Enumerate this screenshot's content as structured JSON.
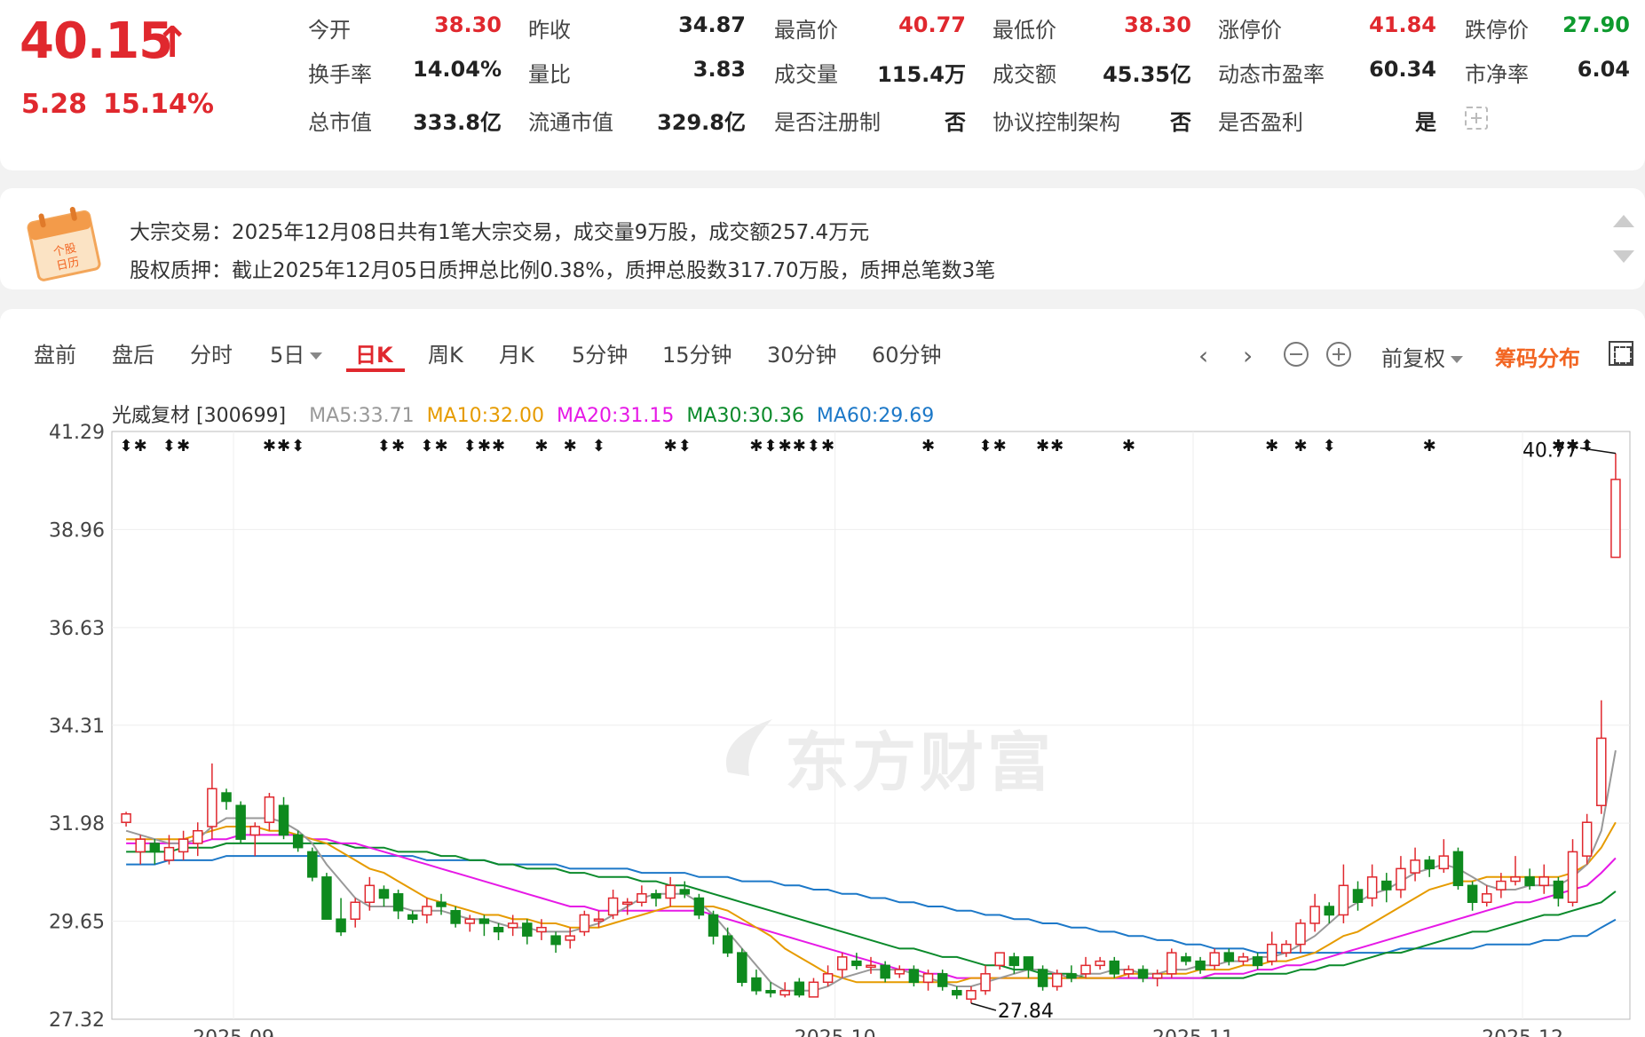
{
  "quote": {
    "price": "40.15",
    "arrow": "↑",
    "change": "5.28",
    "change_pct": "15.14%",
    "fields": [
      {
        "label": "今开",
        "value": "38.30",
        "color": "red"
      },
      {
        "label": "昨收",
        "value": "34.87",
        "color": "dark"
      },
      {
        "label": "最高价",
        "value": "40.77",
        "color": "red"
      },
      {
        "label": "最低价",
        "value": "38.30",
        "color": "red"
      },
      {
        "label": "涨停价",
        "value": "41.84",
        "color": "red"
      },
      {
        "label": "跌停价",
        "value": "27.90",
        "color": "green"
      },
      {
        "label": "换手率",
        "value": "14.04%",
        "color": "dark"
      },
      {
        "label": "量比",
        "value": "3.83",
        "color": "dark"
      },
      {
        "label": "成交量",
        "value": "115.4万",
        "color": "dark"
      },
      {
        "label": "成交额",
        "value": "45.35亿",
        "color": "dark"
      },
      {
        "label": "动态市盈率",
        "value": "60.34",
        "color": "dark"
      },
      {
        "label": "市净率",
        "value": "6.04",
        "color": "dark"
      },
      {
        "label": "总市值",
        "value": "333.8亿",
        "color": "dark"
      },
      {
        "label": "流通市值",
        "value": "329.8亿",
        "color": "dark"
      },
      {
        "label": "是否注册制",
        "value": "否",
        "color": "dark"
      },
      {
        "label": "协议控制架构",
        "value": "否",
        "color": "dark"
      },
      {
        "label": "是否盈利",
        "value": "是",
        "color": "dark"
      }
    ]
  },
  "notice": {
    "icon_text": "个股日历",
    "line1": "大宗交易：2025年12月08日共有1笔大宗交易，成交量9万股，成交额257.4万元",
    "line2": "股权质押：截止2025年12月05日质押总比例0.38%，质押总股数317.70万股，质押总笔数3笔"
  },
  "tabs": [
    {
      "label": "盘前",
      "active": false
    },
    {
      "label": "盘后",
      "active": false
    },
    {
      "label": "分时",
      "active": false
    },
    {
      "label": "5日",
      "active": false,
      "dropdown": true
    },
    {
      "label": "日K",
      "active": true
    },
    {
      "label": "周K",
      "active": false
    },
    {
      "label": "月K",
      "active": false
    },
    {
      "label": "5分钟",
      "active": false
    },
    {
      "label": "15分钟",
      "active": false
    },
    {
      "label": "30分钟",
      "active": false
    },
    {
      "label": "60分钟",
      "active": false
    }
  ],
  "toolbar": {
    "prev": "‹",
    "next": "›",
    "adjust": "前复权",
    "chip": "筹码分布"
  },
  "ma": {
    "name": "光威复材 [300699]",
    "items": [
      {
        "label": "MA5:33.71",
        "color": "#999999"
      },
      {
        "label": "MA10:32.00",
        "color": "#e69b00"
      },
      {
        "label": "MA20:31.15",
        "color": "#e619e6"
      },
      {
        "label": "MA30:30.36",
        "color": "#0b8a2b"
      },
      {
        "label": "MA60:29.69",
        "color": "#1c78c8"
      }
    ]
  },
  "watermark": "东方财富",
  "chart_data": {
    "type": "candlestick",
    "y_ticks": [
      "41.29",
      "38.96",
      "36.63",
      "34.31",
      "31.98",
      "29.65",
      "27.32"
    ],
    "ylim": [
      27.32,
      41.29
    ],
    "x_labels": [
      "2025-09",
      "2025-10",
      "2025-11",
      "2025-12"
    ],
    "high_label": "40.77",
    "low_label": "27.84",
    "colors": {
      "up": "#e0282e",
      "down": "#0e8a1e"
    },
    "candles": [
      [
        32.0,
        32.2,
        32.25,
        31.9
      ],
      [
        31.3,
        31.6,
        31.7,
        31.0
      ],
      [
        31.5,
        31.3,
        31.6,
        31.0
      ],
      [
        31.1,
        31.4,
        31.7,
        31.0
      ],
      [
        31.3,
        31.6,
        31.8,
        31.1
      ],
      [
        31.5,
        31.8,
        32.0,
        31.2
      ],
      [
        31.9,
        32.8,
        33.4,
        31.6
      ],
      [
        32.7,
        32.5,
        32.8,
        32.3
      ],
      [
        32.4,
        31.6,
        32.5,
        31.5
      ],
      [
        31.7,
        31.9,
        32.0,
        31.2
      ],
      [
        32.0,
        32.6,
        32.7,
        31.8
      ],
      [
        32.4,
        31.7,
        32.6,
        31.6
      ],
      [
        31.7,
        31.4,
        31.8,
        31.3
      ],
      [
        31.3,
        30.7,
        31.4,
        30.6
      ],
      [
        30.7,
        29.7,
        30.8,
        29.7
      ],
      [
        29.7,
        29.4,
        30.2,
        29.3
      ],
      [
        29.7,
        30.1,
        30.2,
        29.5
      ],
      [
        30.1,
        30.5,
        30.7,
        29.9
      ],
      [
        30.4,
        30.2,
        30.5,
        30.0
      ],
      [
        30.3,
        29.9,
        30.4,
        29.7
      ],
      [
        29.8,
        29.7,
        29.9,
        29.6
      ],
      [
        29.8,
        30.0,
        30.2,
        29.6
      ],
      [
        30.1,
        30.0,
        30.3,
        29.8
      ],
      [
        29.9,
        29.6,
        30.0,
        29.5
      ],
      [
        29.6,
        29.7,
        29.8,
        29.4
      ],
      [
        29.7,
        29.6,
        29.8,
        29.3
      ],
      [
        29.5,
        29.4,
        29.6,
        29.2
      ],
      [
        29.5,
        29.6,
        29.8,
        29.3
      ],
      [
        29.6,
        29.3,
        29.7,
        29.1
      ],
      [
        29.4,
        29.5,
        29.7,
        29.2
      ],
      [
        29.3,
        29.1,
        29.4,
        28.9
      ],
      [
        29.2,
        29.3,
        29.5,
        29.0
      ],
      [
        29.4,
        29.8,
        29.9,
        29.3
      ],
      [
        29.7,
        29.7,
        29.9,
        29.5
      ],
      [
        29.8,
        30.2,
        30.4,
        29.7
      ],
      [
        30.1,
        30.1,
        30.2,
        29.8
      ],
      [
        30.1,
        30.3,
        30.5,
        30.0
      ],
      [
        30.3,
        30.2,
        30.4,
        30.0
      ],
      [
        30.2,
        30.5,
        30.7,
        30.0
      ],
      [
        30.4,
        30.3,
        30.6,
        30.2
      ],
      [
        30.2,
        29.8,
        30.3,
        29.7
      ],
      [
        29.8,
        29.3,
        29.9,
        29.1
      ],
      [
        29.3,
        28.9,
        29.5,
        28.8
      ],
      [
        28.9,
        28.2,
        29.0,
        28.1
      ],
      [
        28.3,
        28.0,
        28.5,
        27.9
      ],
      [
        28.0,
        27.95,
        28.2,
        27.84
      ],
      [
        27.9,
        28.0,
        28.2,
        27.84
      ],
      [
        28.2,
        27.9,
        28.3,
        27.84
      ],
      [
        27.85,
        28.2,
        28.3,
        27.84
      ],
      [
        28.2,
        28.4,
        28.6,
        28.1
      ],
      [
        28.5,
        28.8,
        28.9,
        28.3
      ],
      [
        28.7,
        28.6,
        28.9,
        28.5
      ],
      [
        28.6,
        28.6,
        28.8,
        28.4
      ],
      [
        28.6,
        28.3,
        28.7,
        28.2
      ],
      [
        28.4,
        28.5,
        28.6,
        28.3
      ],
      [
        28.5,
        28.2,
        28.6,
        28.1
      ],
      [
        28.2,
        28.4,
        28.5,
        28.0
      ],
      [
        28.4,
        28.1,
        28.5,
        28.0
      ],
      [
        28.0,
        27.9,
        28.1,
        27.8
      ],
      [
        27.8,
        28.0,
        28.1,
        27.7
      ],
      [
        28.0,
        28.4,
        28.6,
        27.9
      ],
      [
        28.6,
        28.9,
        28.9,
        28.5
      ],
      [
        28.8,
        28.6,
        28.9,
        28.4
      ],
      [
        28.8,
        28.5,
        28.8,
        28.3
      ],
      [
        28.5,
        28.1,
        28.6,
        28.0
      ],
      [
        28.1,
        28.4,
        28.5,
        28.0
      ],
      [
        28.4,
        28.3,
        28.6,
        28.2
      ],
      [
        28.4,
        28.6,
        28.8,
        28.3
      ],
      [
        28.6,
        28.7,
        28.8,
        28.5
      ],
      [
        28.7,
        28.4,
        28.8,
        28.3
      ],
      [
        28.4,
        28.5,
        28.6,
        28.3
      ],
      [
        28.5,
        28.3,
        28.6,
        28.2
      ],
      [
        28.3,
        28.4,
        28.5,
        28.1
      ],
      [
        28.4,
        28.9,
        29.0,
        28.3
      ],
      [
        28.8,
        28.7,
        28.9,
        28.6
      ],
      [
        28.7,
        28.5,
        28.8,
        28.4
      ],
      [
        28.6,
        28.9,
        29.0,
        28.5
      ],
      [
        28.9,
        28.7,
        29.0,
        28.6
      ],
      [
        28.7,
        28.8,
        28.9,
        28.6
      ],
      [
        28.8,
        28.6,
        28.9,
        28.5
      ],
      [
        28.7,
        29.1,
        29.4,
        28.6
      ],
      [
        28.9,
        29.1,
        29.2,
        28.8
      ],
      [
        29.1,
        29.6,
        29.7,
        28.9
      ],
      [
        29.6,
        30.0,
        30.3,
        29.4
      ],
      [
        30.0,
        29.8,
        30.1,
        29.6
      ],
      [
        29.8,
        30.5,
        31.0,
        29.6
      ],
      [
        30.4,
        30.1,
        30.6,
        29.9
      ],
      [
        30.2,
        30.7,
        31.0,
        30.0
      ],
      [
        30.6,
        30.4,
        30.8,
        30.1
      ],
      [
        30.4,
        30.9,
        31.2,
        30.2
      ],
      [
        30.8,
        31.1,
        31.4,
        30.6
      ],
      [
        31.1,
        30.9,
        31.2,
        30.7
      ],
      [
        30.9,
        31.2,
        31.6,
        30.8
      ],
      [
        31.3,
        30.5,
        31.4,
        30.4
      ],
      [
        30.5,
        30.1,
        30.6,
        29.9
      ],
      [
        30.1,
        30.3,
        30.5,
        30.0
      ],
      [
        30.4,
        30.6,
        30.8,
        30.2
      ],
      [
        30.6,
        30.7,
        31.2,
        30.5
      ],
      [
        30.7,
        30.5,
        30.9,
        30.4
      ],
      [
        30.5,
        30.7,
        31.0,
        30.3
      ],
      [
        30.6,
        30.2,
        30.7,
        30.0
      ],
      [
        30.1,
        31.3,
        31.6,
        30.0
      ],
      [
        31.2,
        32.0,
        32.2,
        31.0
      ],
      [
        32.4,
        34.0,
        34.9,
        32.2
      ],
      [
        38.3,
        40.15,
        40.77,
        38.3
      ]
    ],
    "ma5": [
      31.8,
      31.7,
      31.6,
      31.5,
      31.5,
      31.6,
      31.9,
      32.1,
      32.1,
      32.1,
      32.1,
      32.0,
      31.8,
      31.5,
      31.0,
      30.6,
      30.2,
      30.0,
      30.0,
      30.0,
      29.9,
      29.9,
      29.9,
      29.8,
      29.7,
      29.7,
      29.6,
      29.5,
      29.5,
      29.4,
      29.4,
      29.4,
      29.5,
      29.6,
      29.8,
      30.0,
      30.2,
      30.3,
      30.3,
      30.3,
      30.1,
      29.8,
      29.4,
      29.0,
      28.6,
      28.2,
      28.0,
      28.0,
      28.0,
      28.1,
      28.3,
      28.4,
      28.5,
      28.5,
      28.5,
      28.4,
      28.3,
      28.2,
      28.1,
      28.1,
      28.2,
      28.3,
      28.4,
      28.5,
      28.5,
      28.4,
      28.3,
      28.4,
      28.4,
      28.5,
      28.5,
      28.4,
      28.4,
      28.5,
      28.5,
      28.6,
      28.6,
      28.7,
      28.7,
      28.8,
      28.8,
      28.9,
      29.1,
      29.3,
      29.6,
      29.9,
      30.1,
      30.3,
      30.4,
      30.6,
      30.8,
      30.9,
      31.0,
      30.9,
      30.7,
      30.5,
      30.4,
      30.4,
      30.5,
      30.5,
      30.5,
      30.7,
      31.0,
      31.8,
      33.71
    ],
    "ma10": [
      31.6,
      31.6,
      31.6,
      31.6,
      31.6,
      31.7,
      31.8,
      31.9,
      31.9,
      31.9,
      31.8,
      31.8,
      31.7,
      31.6,
      31.5,
      31.3,
      31.1,
      30.9,
      30.8,
      30.6,
      30.4,
      30.2,
      30.1,
      30.0,
      29.9,
      29.8,
      29.8,
      29.7,
      29.7,
      29.6,
      29.6,
      29.5,
      29.5,
      29.5,
      29.6,
      29.7,
      29.8,
      29.9,
      30.0,
      30.0,
      30.0,
      30.0,
      29.9,
      29.7,
      29.5,
      29.3,
      29.0,
      28.8,
      28.6,
      28.4,
      28.3,
      28.2,
      28.2,
      28.2,
      28.2,
      28.2,
      28.2,
      28.2,
      28.2,
      28.3,
      28.3,
      28.3,
      28.3,
      28.3,
      28.3,
      28.3,
      28.3,
      28.3,
      28.3,
      28.3,
      28.4,
      28.4,
      28.4,
      28.4,
      28.4,
      28.5,
      28.5,
      28.5,
      28.6,
      28.6,
      28.7,
      28.7,
      28.8,
      28.9,
      29.1,
      29.3,
      29.4,
      29.6,
      29.8,
      30.0,
      30.2,
      30.4,
      30.5,
      30.6,
      30.6,
      30.7,
      30.7,
      30.7,
      30.7,
      30.7,
      30.7,
      30.8,
      31.0,
      31.4,
      32.0
    ],
    "ma20": [
      31.5,
      31.5,
      31.5,
      31.5,
      31.5,
      31.5,
      31.6,
      31.6,
      31.7,
      31.7,
      31.7,
      31.7,
      31.7,
      31.6,
      31.6,
      31.5,
      31.5,
      31.4,
      31.3,
      31.2,
      31.1,
      31.0,
      30.9,
      30.8,
      30.7,
      30.6,
      30.5,
      30.4,
      30.3,
      30.2,
      30.1,
      30.0,
      30.0,
      29.9,
      29.9,
      29.9,
      29.9,
      29.9,
      29.9,
      29.9,
      29.9,
      29.8,
      29.7,
      29.6,
      29.5,
      29.4,
      29.3,
      29.2,
      29.1,
      29.0,
      28.9,
      28.8,
      28.7,
      28.6,
      28.5,
      28.5,
      28.4,
      28.4,
      28.3,
      28.3,
      28.3,
      28.3,
      28.3,
      28.3,
      28.3,
      28.3,
      28.3,
      28.3,
      28.3,
      28.3,
      28.3,
      28.3,
      28.3,
      28.3,
      28.3,
      28.3,
      28.4,
      28.4,
      28.4,
      28.5,
      28.5,
      28.6,
      28.6,
      28.7,
      28.8,
      28.9,
      29.0,
      29.1,
      29.2,
      29.3,
      29.4,
      29.5,
      29.6,
      29.7,
      29.8,
      29.9,
      30.0,
      30.1,
      30.1,
      30.2,
      30.3,
      30.4,
      30.5,
      30.8,
      31.15
    ],
    "ma30": [
      31.3,
      31.3,
      31.3,
      31.3,
      31.4,
      31.4,
      31.4,
      31.5,
      31.5,
      31.5,
      31.5,
      31.5,
      31.5,
      31.5,
      31.5,
      31.5,
      31.4,
      31.4,
      31.4,
      31.3,
      31.3,
      31.3,
      31.2,
      31.2,
      31.1,
      31.1,
      31.0,
      31.0,
      30.9,
      30.9,
      30.9,
      30.8,
      30.8,
      30.7,
      30.7,
      30.7,
      30.6,
      30.6,
      30.5,
      30.5,
      30.4,
      30.3,
      30.2,
      30.1,
      30.0,
      29.9,
      29.8,
      29.7,
      29.6,
      29.5,
      29.4,
      29.3,
      29.2,
      29.1,
      29.0,
      29.0,
      28.9,
      28.8,
      28.8,
      28.7,
      28.6,
      28.6,
      28.5,
      28.5,
      28.4,
      28.4,
      28.4,
      28.3,
      28.3,
      28.3,
      28.3,
      28.3,
      28.3,
      28.3,
      28.3,
      28.3,
      28.3,
      28.3,
      28.3,
      28.4,
      28.4,
      28.4,
      28.5,
      28.5,
      28.6,
      28.6,
      28.7,
      28.8,
      28.9,
      28.9,
      29.0,
      29.1,
      29.2,
      29.3,
      29.4,
      29.4,
      29.5,
      29.6,
      29.7,
      29.8,
      29.8,
      29.9,
      30.0,
      30.1,
      30.36
    ],
    "ma60": [
      31.0,
      31.0,
      31.0,
      31.1,
      31.1,
      31.1,
      31.1,
      31.2,
      31.2,
      31.2,
      31.2,
      31.2,
      31.2,
      31.2,
      31.2,
      31.2,
      31.2,
      31.2,
      31.2,
      31.2,
      31.2,
      31.1,
      31.1,
      31.1,
      31.1,
      31.1,
      31.0,
      31.0,
      31.0,
      31.0,
      31.0,
      30.9,
      30.9,
      30.9,
      30.9,
      30.9,
      30.8,
      30.8,
      30.8,
      30.8,
      30.7,
      30.7,
      30.7,
      30.6,
      30.6,
      30.6,
      30.5,
      30.5,
      30.4,
      30.4,
      30.3,
      30.3,
      30.2,
      30.2,
      30.1,
      30.1,
      30.0,
      30.0,
      29.9,
      29.9,
      29.8,
      29.8,
      29.7,
      29.7,
      29.6,
      29.6,
      29.5,
      29.5,
      29.4,
      29.4,
      29.3,
      29.3,
      29.2,
      29.2,
      29.1,
      29.1,
      29.0,
      29.0,
      29.0,
      28.9,
      28.9,
      28.9,
      28.9,
      28.9,
      28.9,
      28.9,
      28.9,
      28.9,
      28.9,
      29.0,
      29.0,
      29.0,
      29.0,
      29.0,
      29.0,
      29.1,
      29.1,
      29.1,
      29.1,
      29.2,
      29.2,
      29.3,
      29.3,
      29.5,
      29.69
    ]
  }
}
